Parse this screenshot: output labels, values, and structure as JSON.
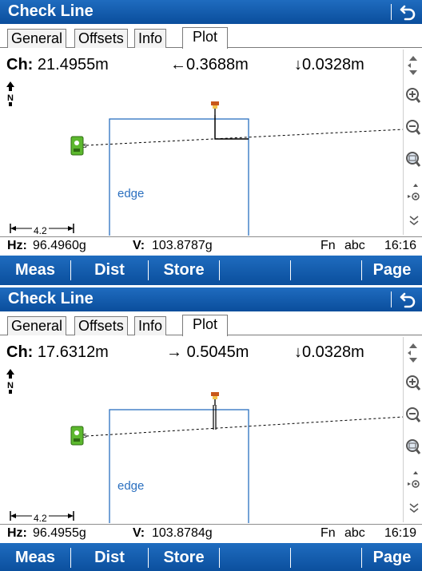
{
  "screens": [
    {
      "title": "Check Line",
      "tabs": [
        "General",
        "Offsets",
        "Info",
        "Plot"
      ],
      "active_tab": "Plot",
      "ch_label": "Ch:",
      "ch_value": "21.4955m",
      "offset_value": "0.3688m",
      "offset_arrow": "←",
      "height_value": "0.0328m",
      "height_arrow": "↓",
      "north_label": "N",
      "edge_label": "edge",
      "scale_label": "4.2",
      "hz_label": "Hz:",
      "hz_value": "96.4960g",
      "v_label": "V:",
      "v_value": "103.8787g",
      "fn_label": "Fn",
      "input_mode": "abc",
      "time": "16:16",
      "softkeys": [
        "Meas",
        "Dist",
        "Store",
        "",
        "",
        "Page"
      ]
    },
    {
      "title": "Check Line",
      "tabs": [
        "General",
        "Offsets",
        "Info",
        "Plot"
      ],
      "active_tab": "Plot",
      "ch_label": "Ch:",
      "ch_value": "17.6312m",
      "offset_value": "0.5045m",
      "offset_arrow": "→",
      "height_value": "0.0328m",
      "height_arrow": "↓",
      "north_label": "N",
      "edge_label": "edge",
      "scale_label": "4.2",
      "hz_label": "Hz:",
      "hz_value": "96.4955g",
      "v_label": "V:",
      "v_value": "103.8784g",
      "fn_label": "Fn",
      "input_mode": "abc",
      "time": "16:19",
      "softkeys": [
        "Meas",
        "Dist",
        "Store",
        "",
        "",
        "Page"
      ]
    }
  ],
  "icons": {
    "back": "back-arrow-icon",
    "north": "north-arrow-icon",
    "instrument": "total-station-icon",
    "prism": "prism-pole-icon",
    "pan": "pan-up-down-icon",
    "zoom_in": "zoom-in-icon",
    "zoom_out": "zoom-out-icon",
    "zoom_extent": "zoom-extent-icon",
    "focus": "focus-target-icon",
    "more": "more-chevron-icon"
  },
  "colors": {
    "title_bar": "#0a4e9c",
    "softkey_bar": "#0a4e9c",
    "edge_line": "#2a6fbf",
    "instrument": "#5cb82e",
    "prism": "#c8571a"
  }
}
